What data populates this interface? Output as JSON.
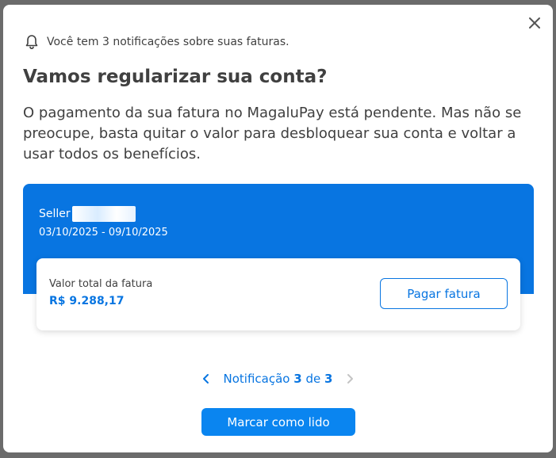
{
  "notification": {
    "summary": "Você tem 3 notificações sobre suas faturas.",
    "title": "Vamos regularizar sua conta?",
    "description": "O pagamento da sua fatura no MagaluPay está pendente. Mas não se preocupe, basta quitar o valor para desbloquear sua conta e voltar a usar todos os benefícios."
  },
  "invoice": {
    "seller_label": "Seller",
    "period": "03/10/2025 - 09/10/2025",
    "total_label": "Valor total da fatura",
    "total_value": "R$ 9.288,17",
    "pay_label": "Pagar fatura"
  },
  "pager": {
    "prefix": "Notificação",
    "current": "3",
    "separator": "de",
    "total": "3"
  },
  "actions": {
    "mark_read_label": "Marcar como lido"
  },
  "colors": {
    "accent": "#0875e1",
    "text": "#404040"
  }
}
